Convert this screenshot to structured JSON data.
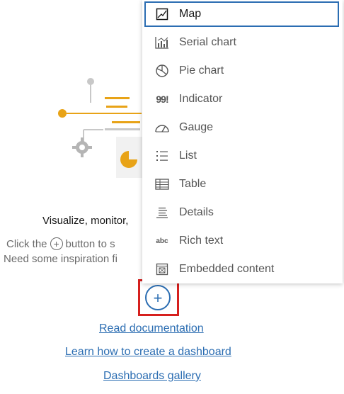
{
  "page": {
    "headline": "Visualize, monitor,",
    "line1_before": "Click the",
    "line1_after": "button to s",
    "line2": "Need some inspiration fi",
    "add_symbol": "+",
    "links": {
      "read_docs": "Read documentation",
      "learn_create": "Learn how to create a dashboard",
      "gallery": "Dashboards gallery"
    }
  },
  "menu": {
    "items": [
      {
        "label": "Map",
        "icon": "map-icon",
        "selected": true
      },
      {
        "label": "Serial chart",
        "icon": "serial-chart-icon"
      },
      {
        "label": "Pie chart",
        "icon": "pie-chart-icon"
      },
      {
        "label": "Indicator",
        "icon": "indicator-icon",
        "glyph": "99!"
      },
      {
        "label": "Gauge",
        "icon": "gauge-icon"
      },
      {
        "label": "List",
        "icon": "list-icon"
      },
      {
        "label": "Table",
        "icon": "table-icon"
      },
      {
        "label": "Details",
        "icon": "details-icon"
      },
      {
        "label": "Rich text",
        "icon": "rich-text-icon",
        "glyph": "abc"
      },
      {
        "label": "Embedded content",
        "icon": "embedded-content-icon"
      }
    ]
  },
  "colors": {
    "accent": "#2b6db2",
    "highlight_box": "#d6201e",
    "illustration_orange": "#e8a317"
  }
}
